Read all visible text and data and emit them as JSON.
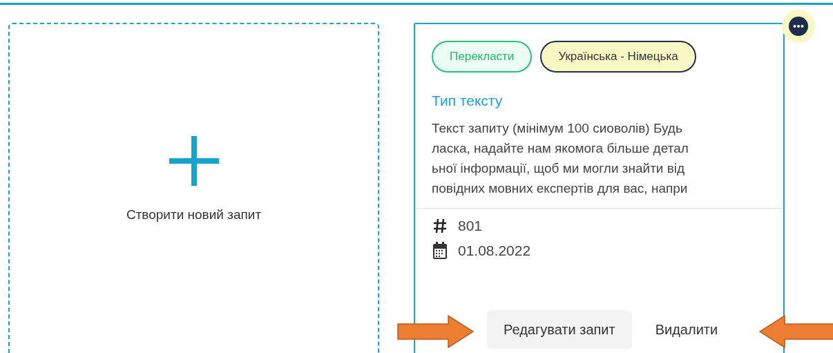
{
  "new_request": {
    "label": "Створити новий запит"
  },
  "request_card": {
    "tags": [
      {
        "label": "Перекласти",
        "kind": "service"
      },
      {
        "label": "Українська - Німецька",
        "kind": "languages"
      }
    ],
    "title": "Тип тексту",
    "description_lines": [
      "Текст запиту (мінімум 100 сиоволів) Будь",
      "ласка, надайте нам якомога більше детал",
      "ьної інформації, щоб ми могли знайти від",
      "повідних мовних експертів для вас, напри"
    ],
    "meta": [
      {
        "kind": "number",
        "value": "801"
      },
      {
        "kind": "date",
        "value": "01.08.2022"
      }
    ],
    "buttons": [
      {
        "label": "Редагувати запит",
        "kind": "filled"
      },
      {
        "label": "Видалити",
        "kind": "plain"
      }
    ]
  }
}
